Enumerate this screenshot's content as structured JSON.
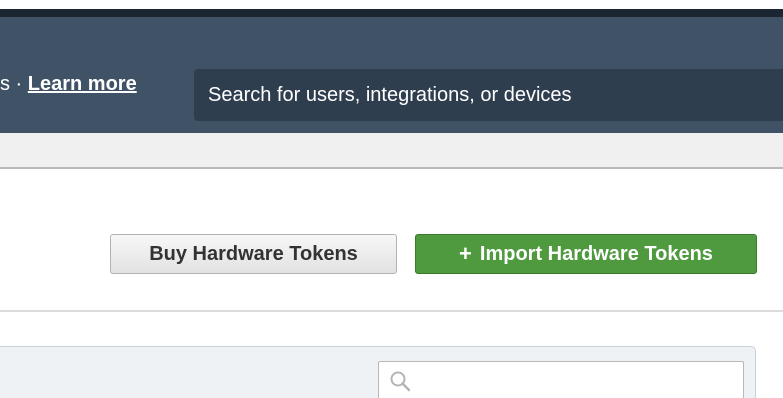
{
  "header": {
    "banner_prefix": "s ·",
    "learn_more_link": "Learn more",
    "global_search": {
      "placeholder": "Search for users, integrations, or devices",
      "value": ""
    }
  },
  "actions": {
    "buy_tokens_label": "Buy Hardware Tokens",
    "import_tokens_plus": "+",
    "import_tokens_label": "Import Hardware Tokens"
  },
  "table": {
    "search": {
      "placeholder": "",
      "value": "",
      "icon": "search-icon"
    }
  },
  "colors": {
    "header_bg": "#405266",
    "header_top_border": "#1c2633",
    "search_bg": "#2f3e4f",
    "import_button_green": "#4f9a3f",
    "buy_button_gray": "#e9e9e9"
  }
}
